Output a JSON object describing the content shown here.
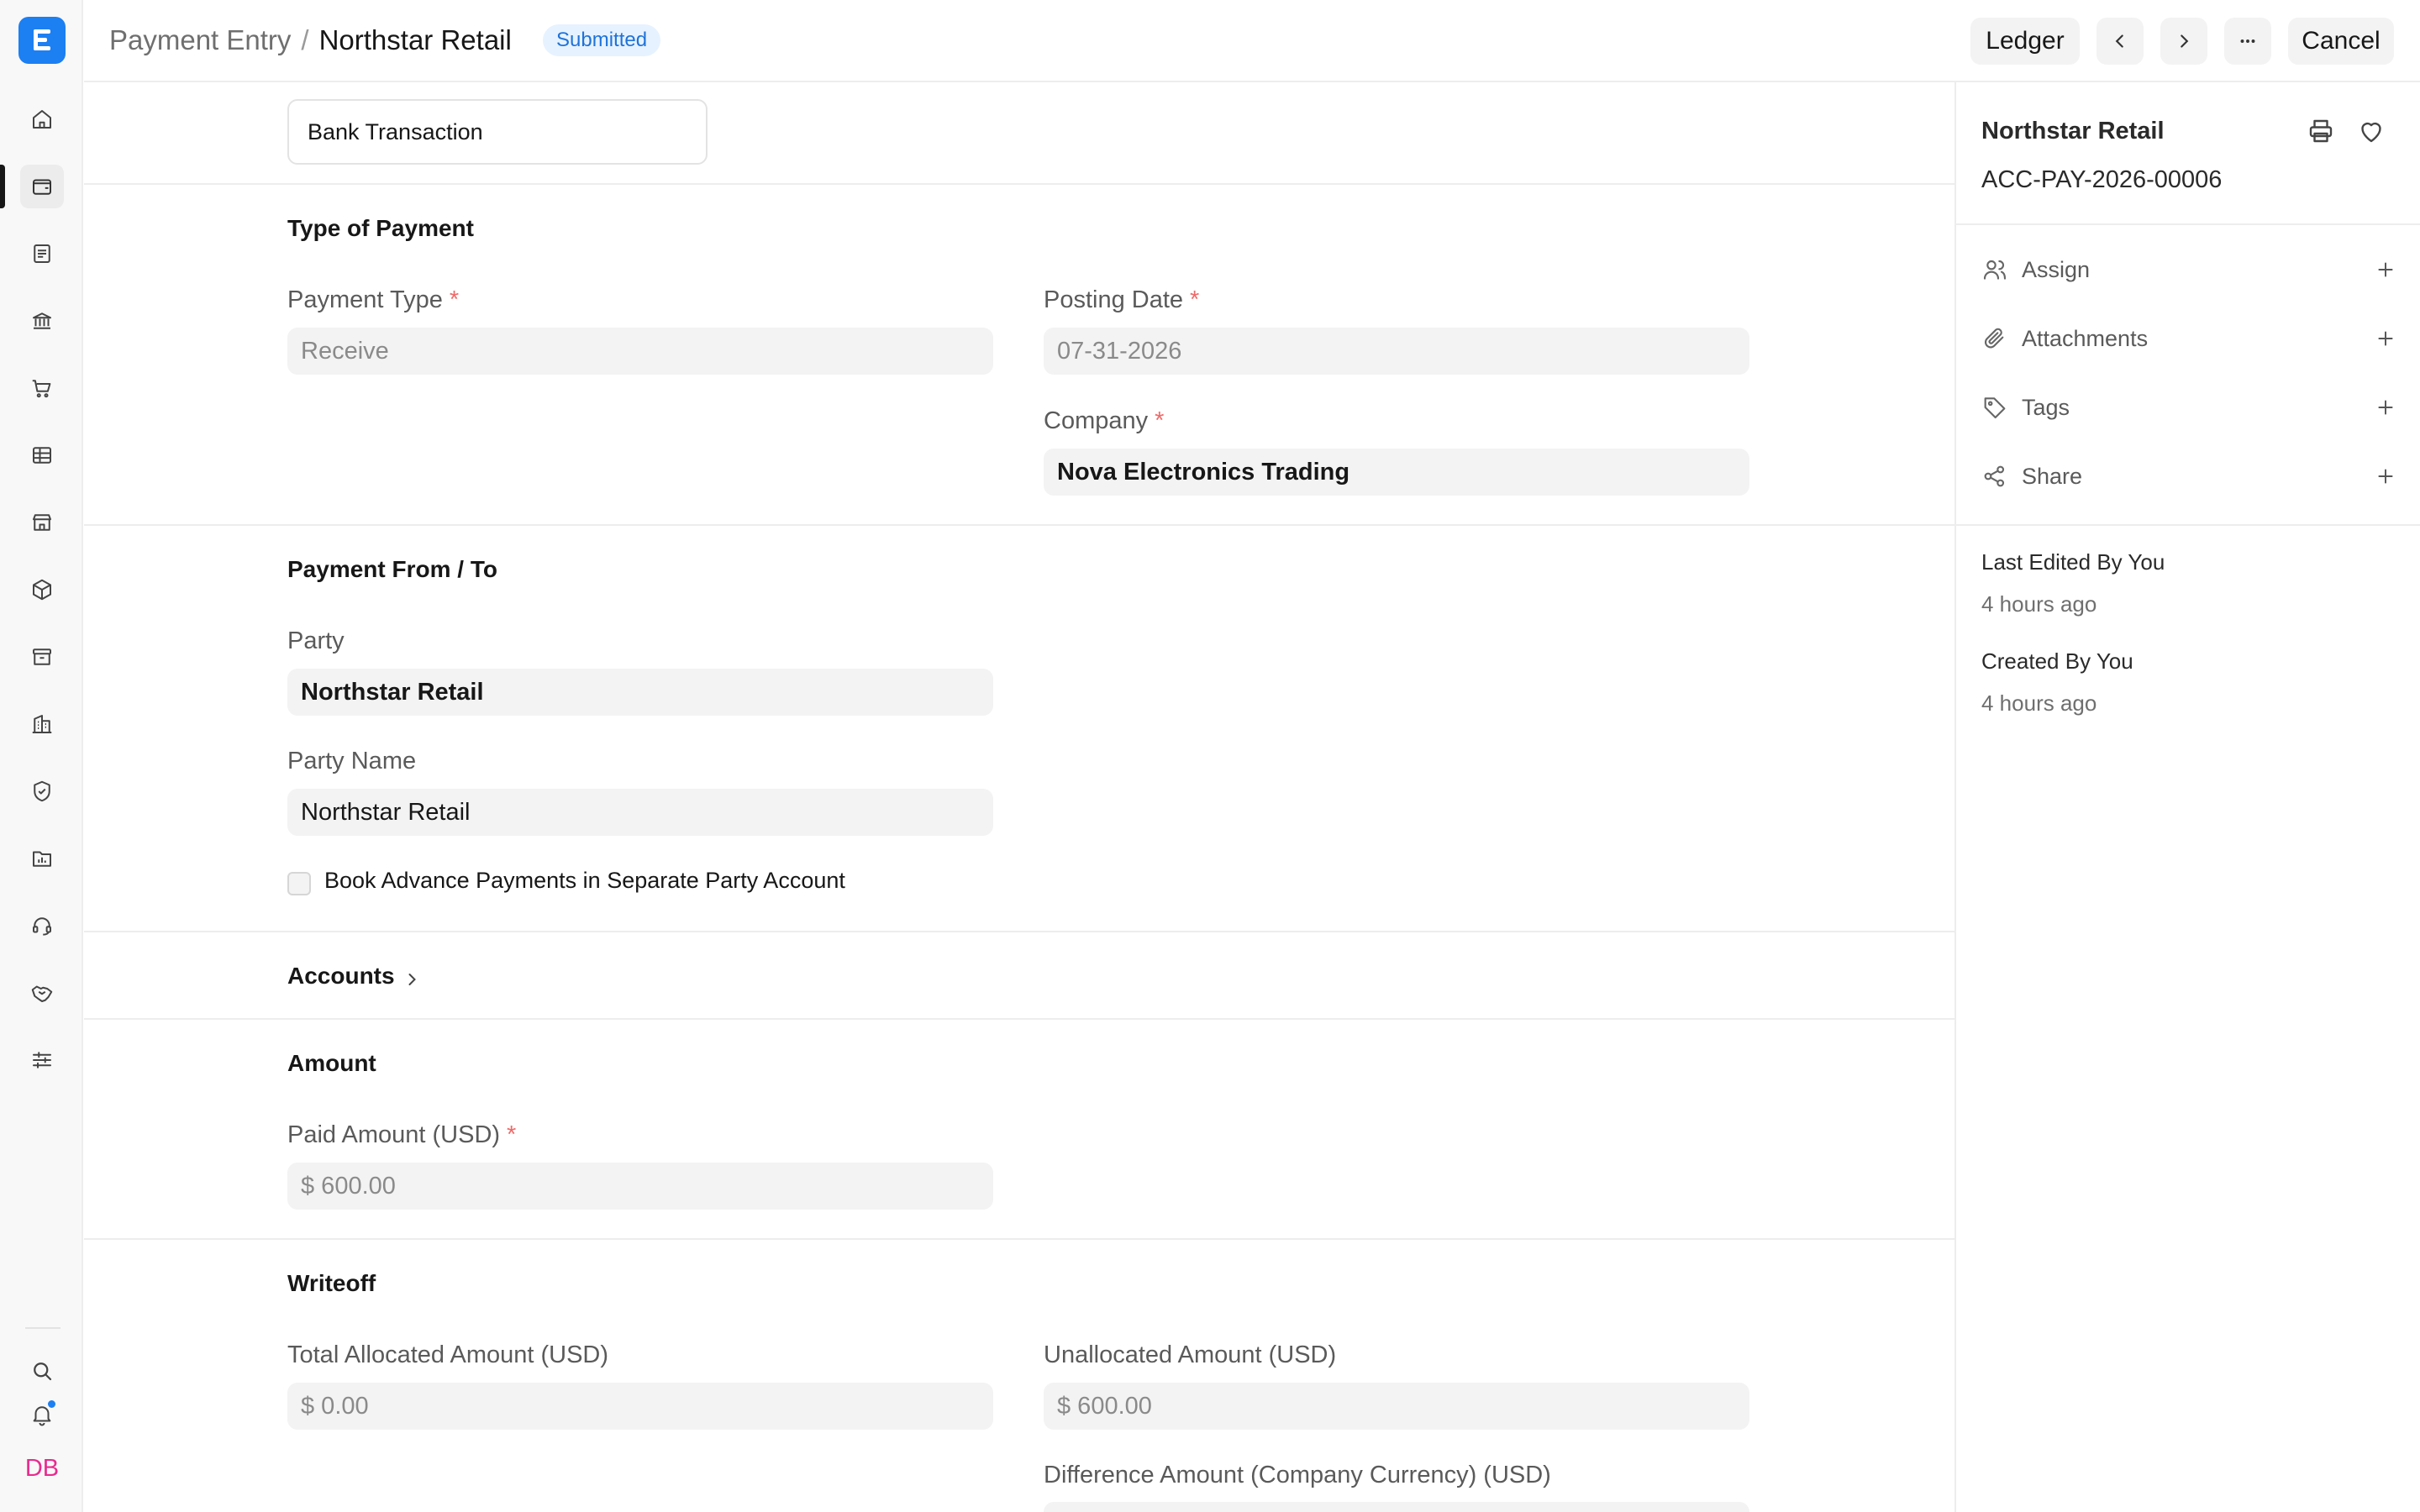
{
  "header": {
    "breadcrumb_parent": "Payment Entry",
    "breadcrumb_separator": "/",
    "title": "Northstar Retail",
    "status_badge": "Submitted",
    "ledger_label": "Ledger",
    "cancel_label": "Cancel"
  },
  "user": {
    "initials": "DB"
  },
  "colors": {
    "accent": "#1c7ff2",
    "badge_bg": "#e6f2ff",
    "badge_text": "#1f73d8",
    "required": "#f06a6a",
    "initials": "#e82b8f"
  },
  "form": {
    "transaction_type_value": "Bank Transaction",
    "required_mark": "*",
    "sections": {
      "type_of_payment": "Type of Payment",
      "payment_from_to": "Payment From / To",
      "accounts": "Accounts",
      "amount": "Amount",
      "writeoff": "Writeoff"
    },
    "fields": {
      "payment_type": {
        "label": "Payment Type",
        "value": "Receive"
      },
      "posting_date": {
        "label": "Posting Date",
        "value": "07-31-2026"
      },
      "company": {
        "label": "Company",
        "value": "Nova Electronics Trading"
      },
      "party": {
        "label": "Party",
        "value": "Northstar Retail"
      },
      "party_name": {
        "label": "Party Name",
        "value": "Northstar Retail"
      },
      "book_advance": {
        "label": "Book Advance Payments in Separate Party Account",
        "checked": false
      },
      "paid_amount": {
        "label": "Paid Amount (USD)",
        "value": "$ 600.00"
      },
      "total_allocated": {
        "label": "Total Allocated Amount (USD)",
        "value": "$ 0.00"
      },
      "unallocated": {
        "label": "Unallocated Amount (USD)",
        "value": "$ 600.00"
      },
      "difference_amount": {
        "label": "Difference Amount (Company Currency) (USD)"
      }
    }
  },
  "sidebar": {
    "title": "Northstar Retail",
    "doc_id": "ACC-PAY-2026-00006",
    "actions": [
      {
        "label": "Assign",
        "icon": "users-icon"
      },
      {
        "label": "Attachments",
        "icon": "paperclip-icon"
      },
      {
        "label": "Tags",
        "icon": "tag-icon"
      },
      {
        "label": "Share",
        "icon": "share-icon"
      }
    ],
    "last_edited_label": "Last Edited By You",
    "last_edited_time": "4 hours ago",
    "created_label": "Created By You",
    "created_time": "4 hours ago"
  },
  "rail": {
    "icons": [
      "home-icon",
      "wallet-icon",
      "document-icon",
      "bank-icon",
      "cart-icon",
      "table-icon",
      "store-icon",
      "box-icon",
      "archive-icon",
      "building-icon",
      "shield-icon",
      "folder-chart-icon",
      "headset-icon",
      "handshake-icon",
      "sliders-icon",
      "search-icon",
      "bell-icon"
    ]
  }
}
